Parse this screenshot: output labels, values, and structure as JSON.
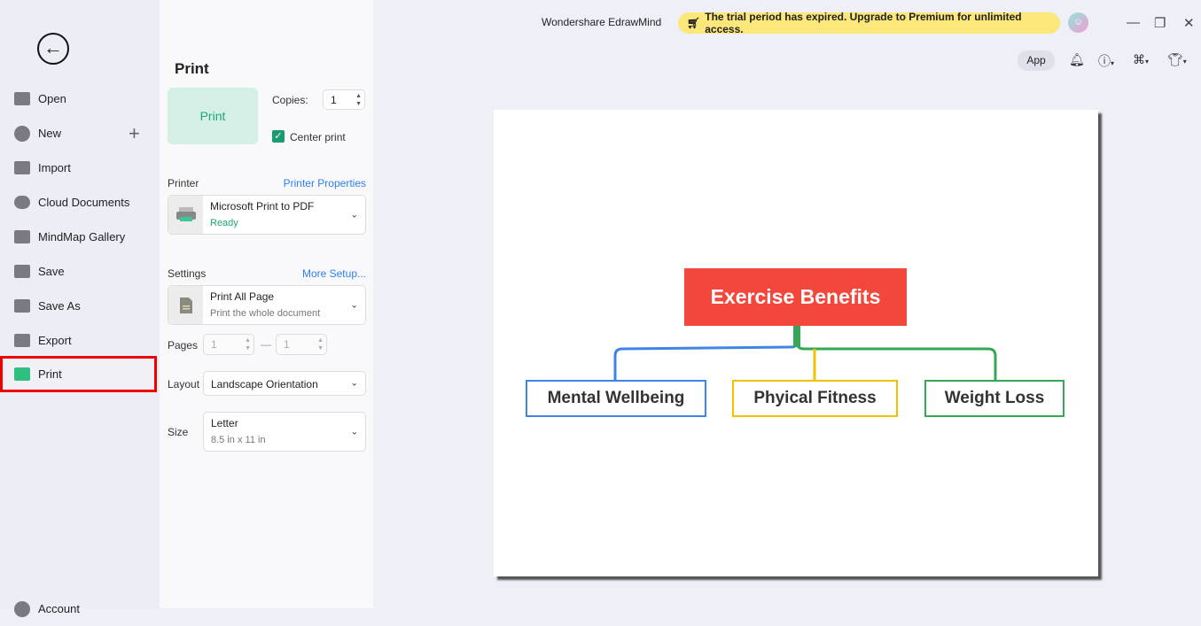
{
  "sidebar": {
    "items": [
      {
        "label": "Open",
        "icon": "folder-icon"
      },
      {
        "label": "New",
        "icon": "plus-circle-icon"
      },
      {
        "label": "Import",
        "icon": "import-icon"
      },
      {
        "label": "Cloud Documents",
        "icon": "cloud-icon"
      },
      {
        "label": "MindMap Gallery",
        "icon": "gallery-icon"
      },
      {
        "label": "Save",
        "icon": "save-icon"
      },
      {
        "label": "Save As",
        "icon": "save-as-icon"
      },
      {
        "label": "Export",
        "icon": "export-icon"
      },
      {
        "label": "Print",
        "icon": "printer-icon",
        "active": true
      },
      {
        "label": "Account",
        "icon": "account-icon"
      }
    ]
  },
  "panel": {
    "title": "Print",
    "print_button": "Print",
    "copies_label": "Copies:",
    "copies": "1",
    "center_print": "Center print",
    "center_print_checked": true,
    "printer_label": "Printer",
    "printer_properties": "Printer Properties",
    "printer_name": "Microsoft Print to PDF",
    "printer_status": "Ready",
    "settings_label": "Settings",
    "more_setup": "More Setup...",
    "settings_value": "Print All Page",
    "settings_desc": "Print the whole document",
    "pages_label": "Pages",
    "page_from": "1",
    "page_to": "1",
    "pages_dash": "—",
    "layout_label": "Layout",
    "layout_value": "Landscape Orientation",
    "size_label": "Size",
    "size_value": "Letter",
    "size_desc": "8.5 in x 11 in"
  },
  "header": {
    "app_title": "Wondershare EdrawMind",
    "trial_message": "The trial period has expired. Upgrade to Premium for unlimited access.",
    "app_button": "App"
  },
  "mindmap": {
    "root": "Exercise Benefits",
    "children": [
      "Mental Wellbeing",
      "Phyical Fitness",
      "Weight Loss"
    ],
    "colors": {
      "root": "#f4473b",
      "children": [
        "#3d85e6",
        "#f2c200",
        "#34a853"
      ]
    }
  }
}
